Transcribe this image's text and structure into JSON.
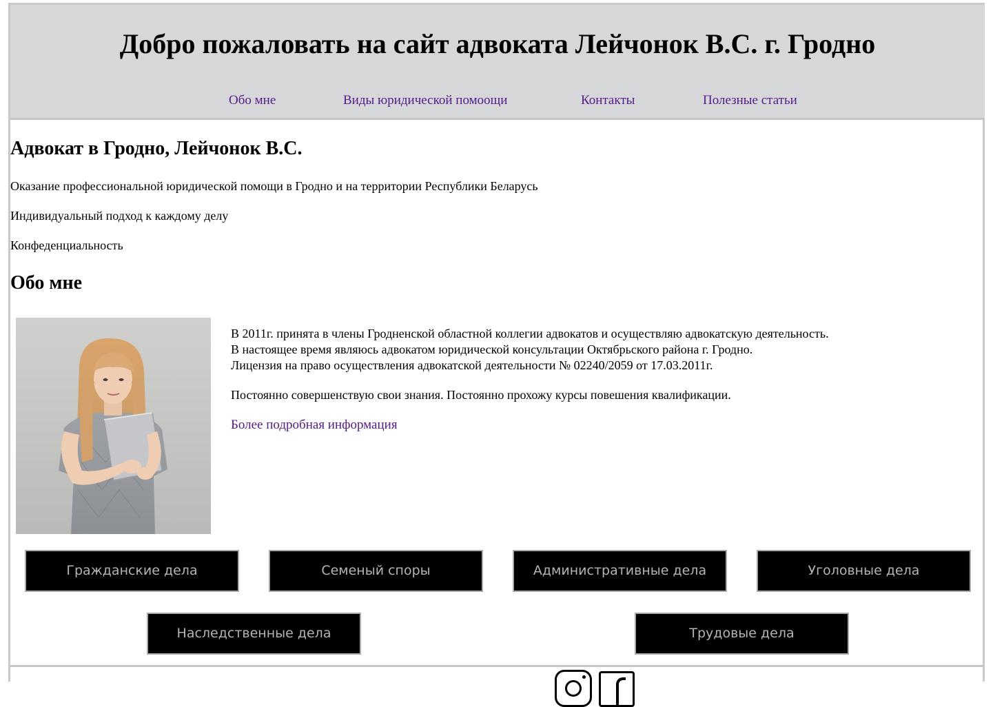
{
  "header": {
    "title": "Добро пожаловать на сайт адвоката Лейчонок В.С. г. Гродно",
    "nav": [
      {
        "label": "Обо мне"
      },
      {
        "label": "Виды юридической помоощи"
      },
      {
        "label": "Контакты"
      },
      {
        "label": "Полезные статьи"
      }
    ],
    "link_color": "#551a8b",
    "background": "#d6d7d9"
  },
  "main": {
    "title": "Адвокат в Гродно, Лейчонок В.С.",
    "points": [
      "Оказание профессиональной юридической помощи в Гродно и на территории Республики Беларусь",
      "Индивидуальный подход к каждому делу",
      "Конфеденциальность"
    ]
  },
  "about": {
    "title": "Обо мне",
    "lines": [
      "В 2011г. принята в члены Гродненской областной коллегии адвокатов и осуществляю адвокатскую деятельность.",
      "В настоящее время являюсь адвокатом юридической консультации Октябрьского района г. Гродно.",
      "Лицензия на право осуществления адвокатской деятельности № 02240/2059 от 17.03.2011г.",
      "Постоянно совершенствую свои знания. Постоянно прохожу курсы повешения квалификации."
    ],
    "more_link": "Более подробная информация"
  },
  "cases": [
    "Гражданские дела",
    "Семеный споры",
    "Административные дела",
    "Уголовные дела",
    "Наследственные дела",
    "Трудовые дела"
  ],
  "footer": {
    "icons": [
      "instagram-icon",
      "facebook-icon"
    ]
  }
}
